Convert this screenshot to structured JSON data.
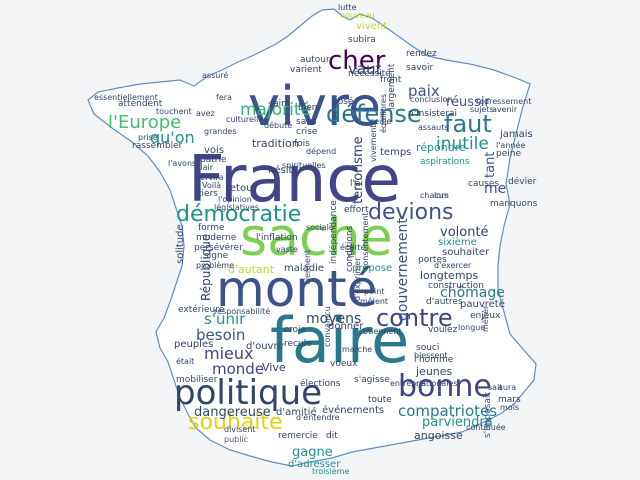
{
  "colors": {
    "background": "#f4f5f7",
    "outline": "#5b8fc7",
    "fill": "#ffffff"
  },
  "words": [
    {
      "text": "France",
      "color": "#414487",
      "orient": "h"
    },
    {
      "text": "faire",
      "color": "#2a788e",
      "orient": "h"
    },
    {
      "text": "vivre",
      "color": "#3b528b",
      "orient": "h"
    },
    {
      "text": "sache",
      "color": "#7ad151",
      "orient": "h"
    },
    {
      "text": "monté",
      "color": "#3b528b",
      "orient": "h"
    },
    {
      "text": "politique",
      "color": "#31446b",
      "orient": "h"
    },
    {
      "text": "démocratie",
      "color": "#21918c",
      "orient": "h"
    },
    {
      "text": "devions",
      "color": "#3b528b",
      "orient": "h"
    },
    {
      "text": "bonne",
      "color": "#414487",
      "orient": "h"
    },
    {
      "text": "cher",
      "color": "#440154",
      "orient": "h"
    },
    {
      "text": "défense",
      "color": "#2a788e",
      "orient": "h"
    },
    {
      "text": "faut",
      "color": "#2a788e",
      "orient": "h"
    },
    {
      "text": "contre",
      "color": "#414487",
      "orient": "h"
    },
    {
      "text": "souhaite",
      "color": "#e3cf1a",
      "orient": "h"
    },
    {
      "text": "compatriotes",
      "color": "#2a788e",
      "orient": "h"
    },
    {
      "text": "majorité",
      "color": "#35b779",
      "orient": "h"
    },
    {
      "text": "l'Europe",
      "color": "#44bf70",
      "orient": "h"
    },
    {
      "text": "qu'on",
      "color": "#21918c",
      "orient": "h"
    },
    {
      "text": "vaut",
      "color": "#31446b",
      "orient": "h"
    },
    {
      "text": "paix",
      "color": "#3b528b",
      "orient": "h"
    },
    {
      "text": "réussir",
      "color": "#3b528b",
      "orient": "h"
    },
    {
      "text": "inutile",
      "color": "#21918c",
      "orient": "h"
    },
    {
      "text": "gouvernement",
      "color": "#3b528b",
      "orient": "v"
    },
    {
      "text": "tant",
      "color": "#3b528b",
      "orient": "v"
    },
    {
      "text": "me",
      "color": "#3b528b",
      "orient": "h"
    },
    {
      "text": "République",
      "color": "#31446b",
      "orient": "v"
    },
    {
      "text": "volonté",
      "color": "#31446b",
      "orient": "h"
    },
    {
      "text": "chômage",
      "color": "#2a788e",
      "orient": "h"
    },
    {
      "text": "besoin",
      "color": "#3b528b",
      "orient": "h"
    },
    {
      "text": "s'unir",
      "color": "#21918c",
      "orient": "h"
    },
    {
      "text": "mieux",
      "color": "#414487",
      "orient": "h"
    },
    {
      "text": "moyens",
      "color": "#31446b",
      "orient": "h"
    },
    {
      "text": "monde",
      "color": "#414487",
      "orient": "h"
    },
    {
      "text": "Vive",
      "color": "#31446b",
      "orient": "h"
    },
    {
      "text": "dangereuse",
      "color": "#31446b",
      "orient": "h"
    },
    {
      "text": "gagne",
      "color": "#21918c",
      "orient": "h"
    },
    {
      "text": "parviendra",
      "color": "#21918c",
      "orient": "h"
    },
    {
      "text": "angoisse",
      "color": "#31446b",
      "orient": "h"
    },
    {
      "text": "d'adresser",
      "color": "#21918c",
      "orient": "h"
    },
    {
      "text": "remercie",
      "color": "#31446b",
      "orient": "h"
    },
    {
      "text": "dit",
      "color": "#31446b",
      "orient": "h"
    },
    {
      "text": "troisième",
      "color": "#21918c",
      "orient": "h"
    },
    {
      "text": "public",
      "color": "#5a5a7a",
      "orient": "h"
    },
    {
      "text": "d'amitié",
      "color": "#31446b",
      "orient": "h"
    },
    {
      "text": "événements",
      "color": "#31446b",
      "orient": "h"
    },
    {
      "text": "s'imposait",
      "color": "#3b528b",
      "orient": "v"
    },
    {
      "text": "pauvreté",
      "color": "#31446b",
      "orient": "h"
    },
    {
      "text": "d'autres",
      "color": "#31446b",
      "orient": "h"
    },
    {
      "text": "longtemps",
      "color": "#31446b",
      "orient": "h"
    },
    {
      "text": "souhaiter",
      "color": "#31446b",
      "orient": "h"
    },
    {
      "text": "sixième",
      "color": "#21918c",
      "orient": "h"
    },
    {
      "text": "propose",
      "color": "#21918c",
      "orient": "h"
    },
    {
      "text": "maladie",
      "color": "#31446b",
      "orient": "h"
    },
    {
      "text": "d'autant",
      "color": "#b5de2b",
      "orient": "h"
    },
    {
      "text": "moderne",
      "color": "#31446b",
      "orient": "h"
    },
    {
      "text": "forme",
      "color": "#31446b",
      "orient": "h"
    },
    {
      "text": "signe",
      "color": "#31446b",
      "orient": "h"
    },
    {
      "text": "l'inflation",
      "color": "#31446b",
      "orient": "h"
    },
    {
      "text": "retour",
      "color": "#31446b",
      "orient": "h"
    },
    {
      "text": "tiers",
      "color": "#31446b",
      "orient": "h"
    },
    {
      "text": "hésiter",
      "color": "#31446b",
      "orient": "h"
    },
    {
      "text": "tradition",
      "color": "#31446b",
      "orient": "h"
    },
    {
      "text": "fois",
      "color": "#31446b",
      "orient": "h"
    },
    {
      "text": "terrorisme",
      "color": "#31446b",
      "orient": "v"
    },
    {
      "text": "répondre",
      "color": "#21918c",
      "orient": "h"
    },
    {
      "text": "temps",
      "color": "#31446b",
      "orient": "h"
    },
    {
      "text": "aspirations",
      "color": "#21918c",
      "orient": "h"
    },
    {
      "text": "nécessité",
      "color": "#31446b",
      "orient": "h"
    },
    {
      "text": "front",
      "color": "#31446b",
      "orient": "h"
    },
    {
      "text": "varient",
      "color": "#31446b",
      "orient": "h"
    },
    {
      "text": "autour",
      "color": "#31446b",
      "orient": "h"
    },
    {
      "text": "rendez",
      "color": "#31446b",
      "orient": "h"
    },
    {
      "text": "n'insisterai",
      "color": "#31446b",
      "orient": "h"
    },
    {
      "text": "savoir",
      "color": "#31446b",
      "orient": "h"
    },
    {
      "text": "subira",
      "color": "#31446b",
      "orient": "h"
    },
    {
      "text": "vivent",
      "color": "#b5de2b",
      "orient": "h"
    },
    {
      "text": "nouveau",
      "color": "#b5de2b",
      "orient": "h"
    },
    {
      "text": "lutte",
      "color": "#31446b",
      "orient": "h"
    },
    {
      "text": "largement",
      "color": "#31446b",
      "orient": "v"
    },
    {
      "text": "attendent",
      "color": "#31446b",
      "orient": "h"
    },
    {
      "text": "rassembler",
      "color": "#31446b",
      "orient": "h"
    },
    {
      "text": "vois",
      "color": "#31446b",
      "orient": "h"
    },
    {
      "text": "patrie",
      "color": "#31446b",
      "orient": "h"
    },
    {
      "text": "Voilà",
      "color": "#31446b",
      "orient": "h"
    },
    {
      "text": "servira",
      "color": "#31446b",
      "orient": "h"
    },
    {
      "text": "clair",
      "color": "#31446b",
      "orient": "h"
    },
    {
      "text": "l'avons",
      "color": "#31446b",
      "orient": "h"
    },
    {
      "text": "solitude",
      "color": "#31446b",
      "orient": "v"
    },
    {
      "text": "persévérer",
      "color": "#31446b",
      "orient": "h"
    },
    {
      "text": "problème",
      "color": "#31446b",
      "orient": "h"
    },
    {
      "text": "extérieure",
      "color": "#31446b",
      "orient": "h"
    },
    {
      "text": "peuples",
      "color": "#31446b",
      "orient": "h"
    },
    {
      "text": "mobiliser",
      "color": "#31446b",
      "orient": "h"
    },
    {
      "text": "responsabilité",
      "color": "#31446b",
      "orient": "h"
    },
    {
      "text": "d'ouvrir",
      "color": "#31446b",
      "orient": "h"
    },
    {
      "text": "croie",
      "color": "#31446b",
      "orient": "h"
    },
    {
      "text": "recule",
      "color": "#31446b",
      "orient": "h"
    },
    {
      "text": "donner",
      "color": "#31446b",
      "orient": "h"
    },
    {
      "text": "obtiennent",
      "color": "#31446b",
      "orient": "h"
    },
    {
      "text": "voulez",
      "color": "#31446b",
      "orient": "h"
    },
    {
      "text": "enjeux",
      "color": "#31446b",
      "orient": "h"
    },
    {
      "text": "longue",
      "color": "#31446b",
      "orient": "h"
    },
    {
      "text": "jeunes",
      "color": "#31446b",
      "orient": "h"
    },
    {
      "text": "l'homme",
      "color": "#31446b",
      "orient": "h"
    },
    {
      "text": "souci",
      "color": "#31446b",
      "orient": "h"
    },
    {
      "text": "blessent",
      "color": "#31446b",
      "orient": "h"
    },
    {
      "text": "s'agisse",
      "color": "#31446b",
      "orient": "h"
    },
    {
      "text": "élections",
      "color": "#31446b",
      "orient": "h"
    },
    {
      "text": "voeux",
      "color": "#31446b",
      "orient": "h"
    },
    {
      "text": "marche",
      "color": "#31446b",
      "orient": "h"
    },
    {
      "text": "toute",
      "color": "#31446b",
      "orient": "h"
    },
    {
      "text": "d'entendre",
      "color": "#31446b",
      "orient": "h"
    },
    {
      "text": "divisent",
      "color": "#31446b",
      "orient": "h"
    },
    {
      "text": "jamais",
      "color": "#31446b",
      "orient": "h"
    },
    {
      "text": "peine",
      "color": "#31446b",
      "orient": "h"
    },
    {
      "text": "dévier",
      "color": "#31446b",
      "orient": "h"
    },
    {
      "text": "manquons",
      "color": "#31446b",
      "orient": "h"
    },
    {
      "text": "causes",
      "color": "#31446b",
      "orient": "h"
    },
    {
      "text": "mars",
      "color": "#31446b",
      "orient": "h"
    },
    {
      "text": "crise",
      "color": "#31446b",
      "orient": "h"
    },
    {
      "text": "sans",
      "color": "#31446b",
      "orient": "h"
    },
    {
      "text": "bien",
      "color": "#31446b",
      "orient": "h"
    },
    {
      "text": "faim",
      "color": "#31446b",
      "orient": "h"
    },
    {
      "text": "posé",
      "color": "#31446b",
      "orient": "h"
    },
    {
      "text": "débuté",
      "color": "#31446b",
      "orient": "h"
    },
    {
      "text": "grandes",
      "color": "#31446b",
      "orient": "h"
    },
    {
      "text": "fera",
      "color": "#31446b",
      "orient": "h"
    },
    {
      "text": "effort",
      "color": "#31446b",
      "orient": "h"
    },
    {
      "text": "l'opinion",
      "color": "#31446b",
      "orient": "h"
    },
    {
      "text": "législatives",
      "color": "#31446b",
      "orient": "h"
    },
    {
      "text": "l'ai",
      "color": "#31446b",
      "orient": "h"
    },
    {
      "text": "conditions",
      "color": "#31446b",
      "orient": "v"
    },
    {
      "text": "portes",
      "color": "#31446b",
      "orient": "h"
    },
    {
      "text": "d'exercer",
      "color": "#31446b",
      "orient": "h"
    },
    {
      "text": "construction",
      "color": "#31446b",
      "orient": "h"
    },
    {
      "text": "mêlent",
      "color": "#31446b",
      "orient": "h"
    },
    {
      "text": "point",
      "color": "#31446b",
      "orient": "h"
    },
    {
      "text": "vaste",
      "color": "#31446b",
      "orient": "h"
    },
    {
      "text": "indépendance",
      "color": "#31446b",
      "orient": "v"
    },
    {
      "text": "consentement",
      "color": "#31446b",
      "orient": "v"
    },
    {
      "text": "d'exprimer",
      "color": "#31446b",
      "orient": "v"
    },
    {
      "text": "convaincu",
      "color": "#31446b",
      "orient": "v"
    },
    {
      "text": "vivement",
      "color": "#31446b",
      "orient": "v"
    },
    {
      "text": "seule",
      "color": "#31446b",
      "orient": "h"
    },
    {
      "text": "assauts",
      "color": "#31446b",
      "orient": "h"
    },
    {
      "text": "conclusion",
      "color": "#31446b",
      "orient": "h"
    },
    {
      "text": "redressement",
      "color": "#31446b",
      "orient": "h"
    },
    {
      "text": "avenir",
      "color": "#31446b",
      "orient": "h"
    },
    {
      "text": "l'année",
      "color": "#31446b",
      "orient": "h"
    },
    {
      "text": "continuée",
      "color": "#31446b",
      "orient": "h"
    },
    {
      "text": "essentiellement",
      "color": "#31446b",
      "orient": "h"
    },
    {
      "text": "touchent",
      "color": "#31446b",
      "orient": "h"
    },
    {
      "text": "assuré",
      "color": "#31446b",
      "orient": "h"
    },
    {
      "text": "prise",
      "color": "#31446b",
      "orient": "h"
    },
    {
      "text": "avez",
      "color": "#31446b",
      "orient": "h"
    },
    {
      "text": "entrepris",
      "color": "#31446b",
      "orient": "h"
    },
    {
      "text": "nationales",
      "color": "#31446b",
      "orient": "h"
    },
    {
      "text": "viennent",
      "color": "#31446b",
      "orient": "v"
    },
    {
      "text": "chacun",
      "color": "#31446b",
      "orient": "h"
    },
    {
      "text": "lors",
      "color": "#31446b",
      "orient": "h"
    },
    {
      "text": "sujets",
      "color": "#31446b",
      "orient": "h"
    },
    {
      "text": "était",
      "color": "#31446b",
      "orient": "h"
    },
    {
      "text": "dépend",
      "color": "#31446b",
      "orient": "h"
    },
    {
      "text": "sait",
      "color": "#31446b",
      "orient": "h"
    },
    {
      "text": "fixé",
      "color": "#31446b",
      "orient": "v"
    },
    {
      "text": "métier",
      "color": "#31446b",
      "orient": "v"
    },
    {
      "text": "aura",
      "color": "#31446b",
      "orient": "h"
    },
    {
      "text": "mois",
      "color": "#31446b",
      "orient": "h"
    },
    {
      "text": "sociale",
      "color": "#31446b",
      "orient": "h"
    },
    {
      "text": "écarté",
      "color": "#31446b",
      "orient": "h"
    },
    {
      "text": "spirituelles",
      "color": "#31446b",
      "orient": "h"
    },
    {
      "text": "culturelles",
      "color": "#31446b",
      "orient": "h"
    },
    {
      "text": "équilibres",
      "color": "#31446b",
      "orient": "v"
    }
  ]
}
